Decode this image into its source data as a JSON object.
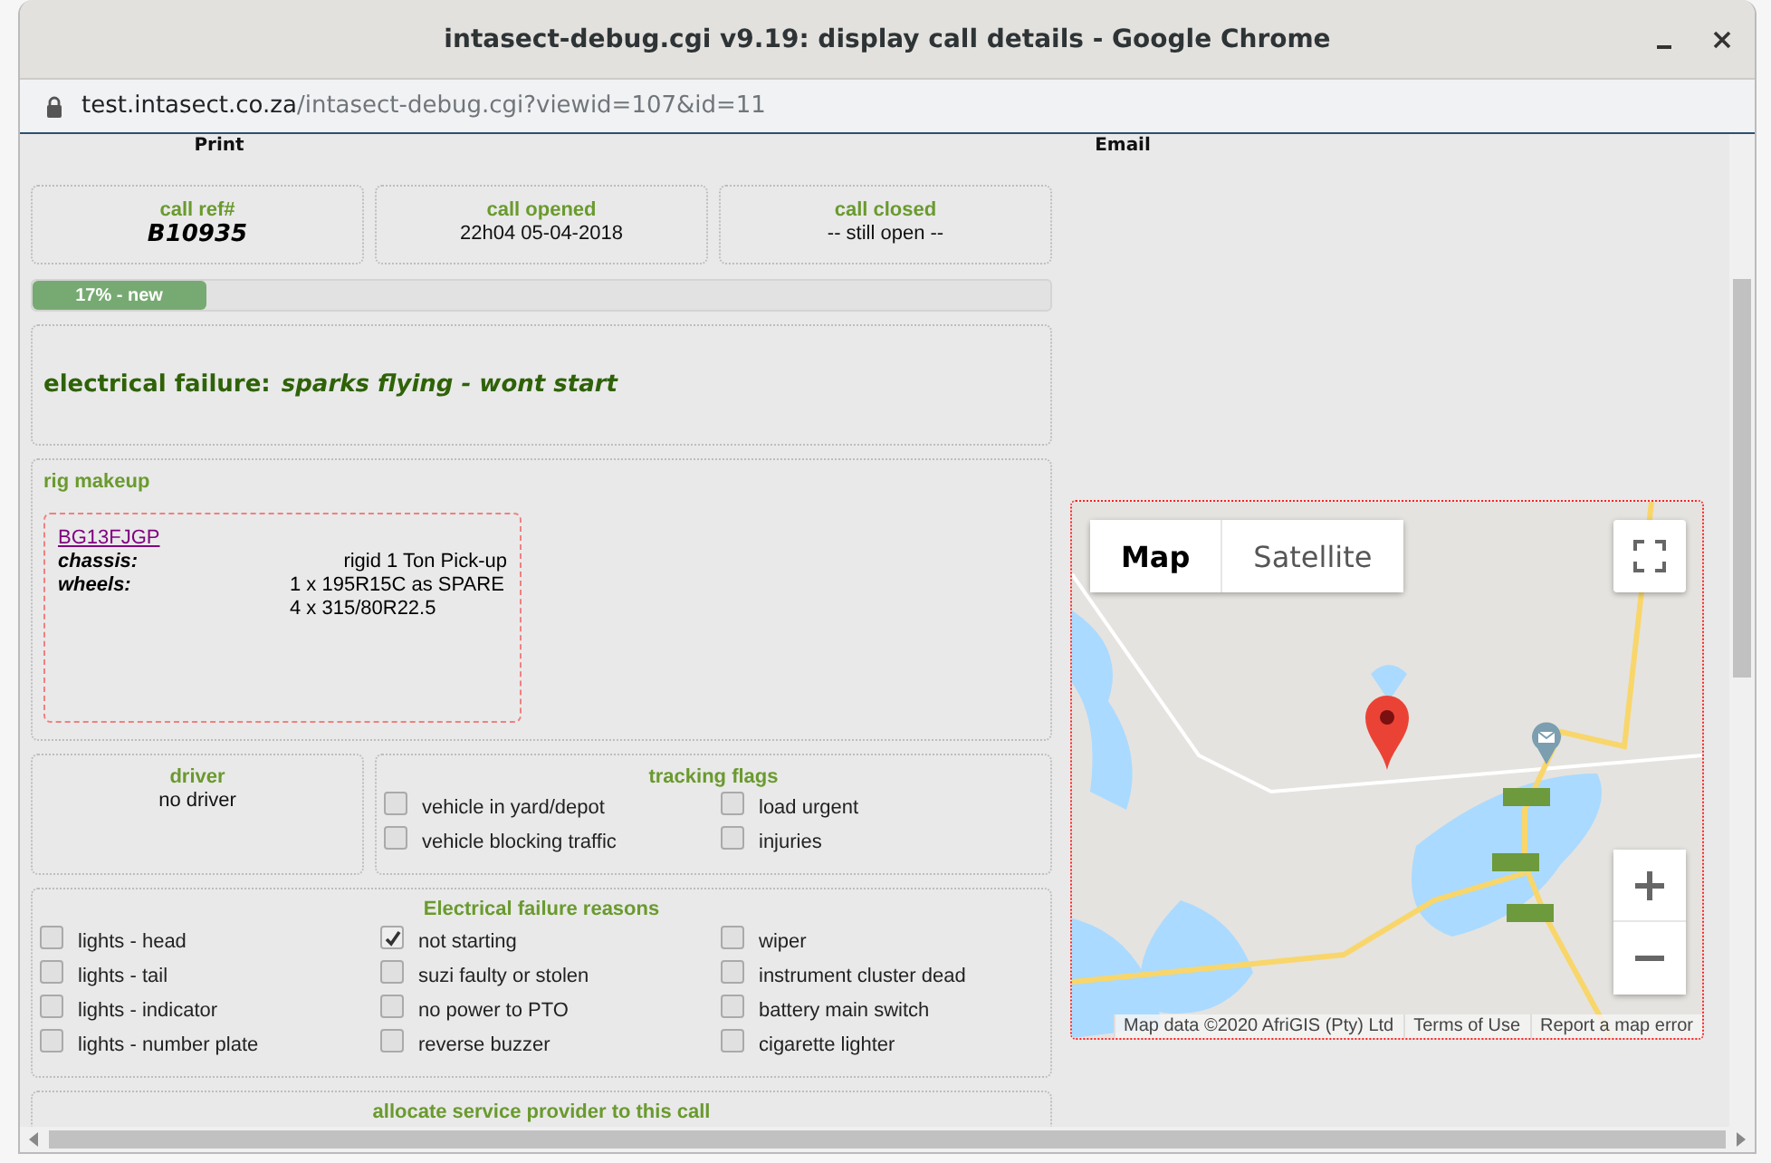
{
  "window": {
    "title": "intasect-debug.cgi v9.19: display call details - Google Chrome",
    "url_host": "test.intasect.co.za",
    "url_path": "/intasect-debug.cgi?viewid=107&id=11"
  },
  "header_links": [
    "Print",
    "Email"
  ],
  "call_info": [
    {
      "kind": "ref",
      "label": "call ref#",
      "value": "B10935"
    },
    {
      "kind": "plain",
      "label": "call opened",
      "value": "22h04 05-04-2018"
    },
    {
      "kind": "plain",
      "label": "call closed",
      "value": "-- still open --"
    }
  ],
  "progress": {
    "label": "17% - new",
    "level": 0.17
  },
  "fault": {
    "category": "electrical failure:",
    "description": "sparks flying - wont start"
  },
  "rig": {
    "title": "rig makeup",
    "registration": "BG13FJGP",
    "specs": [
      {
        "label": "chassis:",
        "values": [
          "rigid 1 Ton Pick-up"
        ]
      },
      {
        "label": "wheels:",
        "values": [
          "1 x 195R15C as SPARE",
          "4 x 315/80R22.5"
        ]
      }
    ]
  },
  "driver": {
    "title": "driver",
    "value": "no driver"
  },
  "tracking_flags": {
    "title": "tracking flags",
    "items": [
      {
        "label": "vehicle in yard/depot",
        "checked": false
      },
      {
        "label": "load urgent",
        "checked": false
      },
      {
        "label": "vehicle blocking traffic",
        "checked": false
      },
      {
        "label": "injuries",
        "checked": false
      }
    ]
  },
  "reasons": {
    "title": "Electrical failure reasons",
    "items": [
      {
        "label": "lights - head",
        "checked": false
      },
      {
        "label": "not starting",
        "checked": true
      },
      {
        "label": "wiper",
        "checked": false
      },
      {
        "label": "lights - tail",
        "checked": false
      },
      {
        "label": "suzi faulty or stolen",
        "checked": false
      },
      {
        "label": "instrument cluster dead",
        "checked": false
      },
      {
        "label": "lights - indicator",
        "checked": false
      },
      {
        "label": "no power to PTO",
        "checked": false
      },
      {
        "label": "battery main switch",
        "checked": false
      },
      {
        "label": "lights - number plate",
        "checked": false
      },
      {
        "label": "reverse buzzer",
        "checked": false
      },
      {
        "label": "cigarette lighter",
        "checked": false
      }
    ]
  },
  "allocate": {
    "title": "allocate service provider to this call"
  },
  "map": {
    "types": [
      {
        "label": "Map",
        "selected": true
      },
      {
        "label": "Satellite",
        "selected": false
      }
    ],
    "attribution": [
      "Map data ©2020 AfriGIS (Pty) Ltd",
      "Terms of Use",
      "Report a map error"
    ]
  }
}
